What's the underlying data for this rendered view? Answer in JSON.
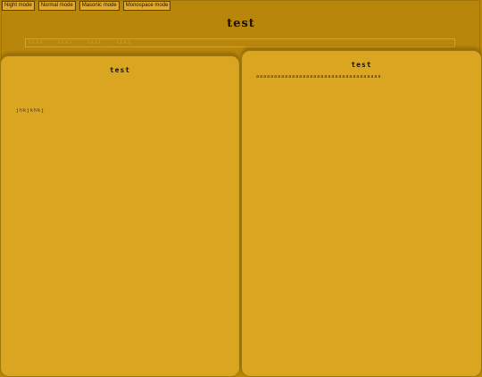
{
  "modes": [
    {
      "label": "Night mode"
    },
    {
      "label": "Normal mode"
    },
    {
      "label": "Masonic mode"
    },
    {
      "label": "Monospace mode"
    }
  ],
  "site": {
    "title": "test"
  },
  "nav": [
    {
      "label": "TEXT"
    },
    {
      "label": "TEXT"
    },
    {
      "label": "TEXT"
    },
    {
      "label": "TEXT"
    }
  ],
  "panels": {
    "left": {
      "title": "test",
      "text": "jhkjkhkj"
    },
    "right": {
      "title": "test",
      "text": "aaaaaaaaaaaaaaaaaaaaaaaaaaaaaaaaaaa"
    }
  },
  "colors": {
    "background": "#b8860b",
    "panel": "#daa520",
    "nav_text": "#d9a62c"
  }
}
